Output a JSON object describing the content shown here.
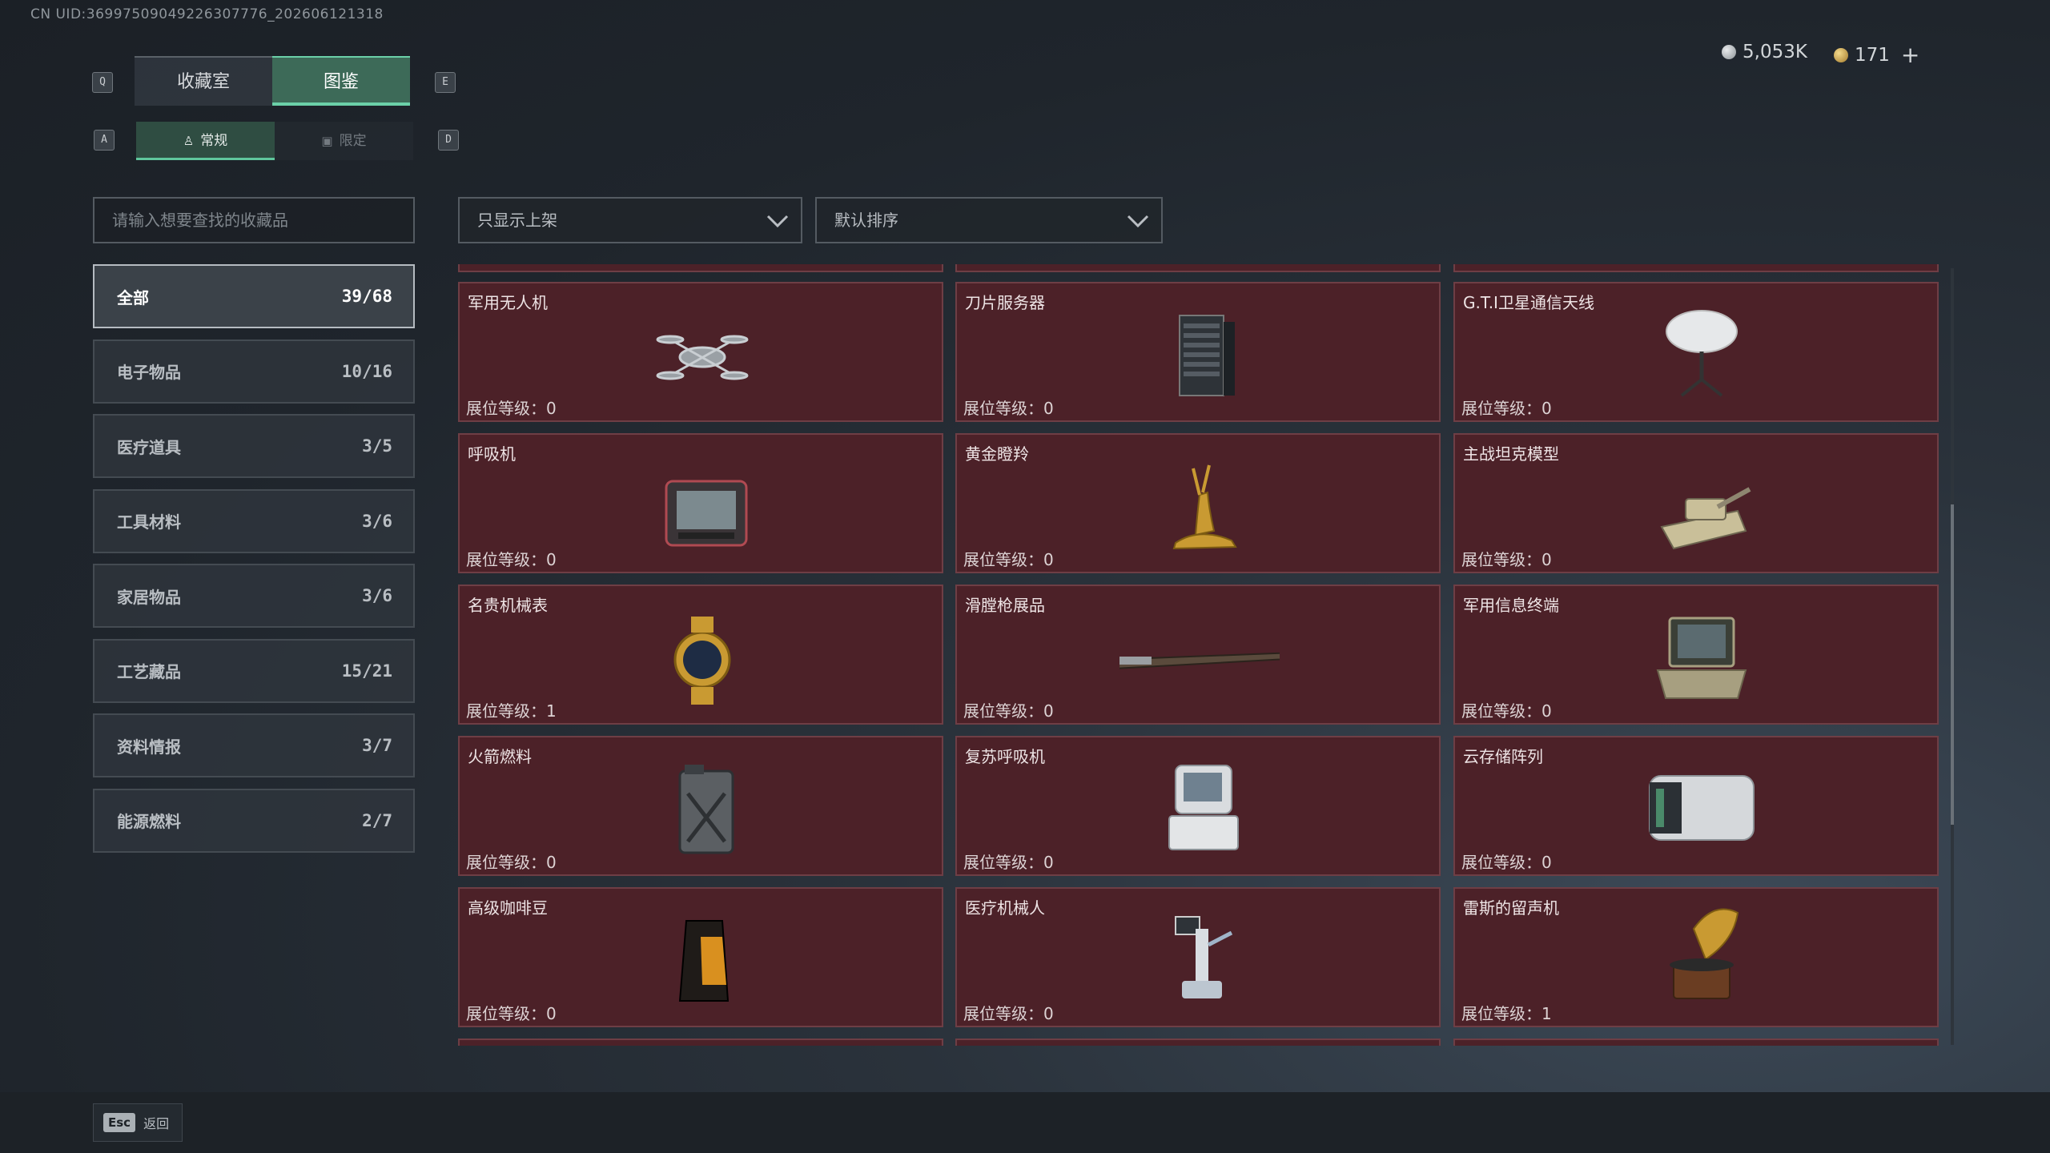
{
  "uid_text": "CN UID:3699750904922630777​6_202606121318",
  "header": {
    "key_q": "Q",
    "key_e": "E",
    "key_a": "A",
    "key_d": "D",
    "tabs": [
      "收藏室",
      "图鉴"
    ],
    "subtabs": [
      "常规",
      "限定"
    ],
    "currency1": "5,053K",
    "currency2": "171",
    "plus": "+"
  },
  "search": {
    "placeholder": "请输入想要查找的收藏品"
  },
  "filters": {
    "shelf": "只显示上架",
    "sort": "默认排序"
  },
  "categories": [
    {
      "label": "全部",
      "count": "39/68"
    },
    {
      "label": "电子物品",
      "count": "10/16"
    },
    {
      "label": "医疗道具",
      "count": "3/5"
    },
    {
      "label": "工具材料",
      "count": "3/6"
    },
    {
      "label": "家居物品",
      "count": "3/6"
    },
    {
      "label": "工艺藏品",
      "count": "15/21"
    },
    {
      "label": "资料情报",
      "count": "3/7"
    },
    {
      "label": "能源燃料",
      "count": "2/7"
    }
  ],
  "level_label": "展位等级：",
  "items": [
    {
      "name": "军用无人机",
      "level": "0",
      "icon": "drone-icon"
    },
    {
      "name": "刀片服务器",
      "level": "0",
      "icon": "server-icon"
    },
    {
      "name": "G.T.I卫星通信天线",
      "level": "0",
      "icon": "satellite-dish-icon"
    },
    {
      "name": "呼吸机",
      "level": "0",
      "icon": "ventilator-icon"
    },
    {
      "name": "黄金瞪羚",
      "level": "0",
      "icon": "gazelle-statue-icon"
    },
    {
      "name": "主战坦克模型",
      "level": "0",
      "icon": "tank-model-icon"
    },
    {
      "name": "名贵机械表",
      "level": "1",
      "icon": "watch-icon"
    },
    {
      "name": "滑膛枪展品",
      "level": "0",
      "icon": "musket-icon"
    },
    {
      "name": "军用信息终端",
      "level": "0",
      "icon": "terminal-case-icon"
    },
    {
      "name": "火箭燃料",
      "level": "0",
      "icon": "fuel-can-icon"
    },
    {
      "name": "复苏呼吸机",
      "level": "0",
      "icon": "resuscitator-icon"
    },
    {
      "name": "云存储阵列",
      "level": "0",
      "icon": "storage-array-icon"
    },
    {
      "name": "高级咖啡豆",
      "level": "0",
      "icon": "coffee-bag-icon"
    },
    {
      "name": "医疗机械人",
      "level": "0",
      "icon": "medical-robot-icon"
    },
    {
      "name": "雷斯的留声机",
      "level": "1",
      "icon": "gramophone-icon"
    }
  ],
  "footer": {
    "esc_key": "Esc",
    "back_label": "返回"
  },
  "colors": {
    "accent": "#6bd0a8",
    "card_bg": "#4c2128",
    "card_border": "#6e3e45"
  }
}
